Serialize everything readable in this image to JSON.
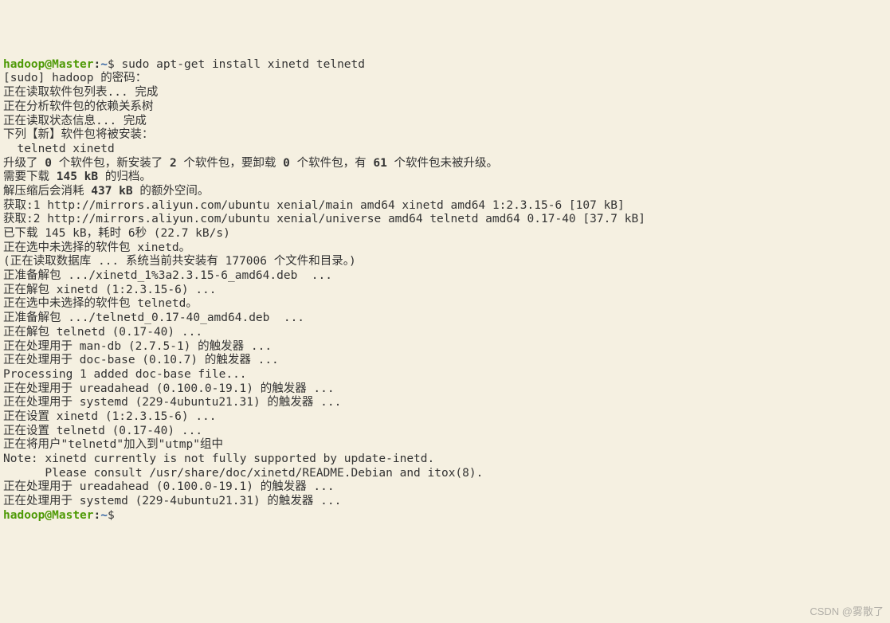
{
  "prompt": {
    "user": "hadoop",
    "host": "Master",
    "path": "~",
    "symbol": "$"
  },
  "command": "sudo apt-get install xinetd telnetd",
  "lines": {
    "l1": "[sudo] hadoop 的密码：",
    "l2": "正在读取软件包列表... 完成",
    "l3": "正在分析软件包的依赖关系树",
    "l4": "正在读取状态信息... 完成",
    "l5": "下列【新】软件包将被安装：",
    "l6": "  telnetd xinetd",
    "upgrade_a": "升级了 ",
    "upgrade_n1": "0",
    "upgrade_b": " 个软件包，新安装了 ",
    "upgrade_n2": "2",
    "upgrade_c": " 个软件包，要卸载 ",
    "upgrade_n3": "0",
    "upgrade_d": " 个软件包，有 ",
    "upgrade_n4": "61",
    "upgrade_e": " 个软件包未被升级。",
    "dl_a": "需要下载 ",
    "dl_n": "145 kB",
    "dl_b": " 的归档。",
    "sp_a": "解压缩后会消耗 ",
    "sp_n": "437 kB",
    "sp_b": " 的额外空间。",
    "l10": "获取:1 http://mirrors.aliyun.com/ubuntu xenial/main amd64 xinetd amd64 1:2.3.15-6 [107 kB]",
    "l11": "获取:2 http://mirrors.aliyun.com/ubuntu xenial/universe amd64 telnetd amd64 0.17-40 [37.7 kB]",
    "l12": "已下载 145 kB，耗时 6秒 (22.7 kB/s)",
    "l13": "正在选中未选择的软件包 xinetd。",
    "l14": "(正在读取数据库 ... 系统当前共安装有 177006 个文件和目录。)",
    "l15": "正准备解包 .../xinetd_1%3a2.3.15-6_amd64.deb  ...",
    "l16": "正在解包 xinetd (1:2.3.15-6) ...",
    "l17": "正在选中未选择的软件包 telnetd。",
    "l18": "正准备解包 .../telnetd_0.17-40_amd64.deb  ...",
    "l19": "正在解包 telnetd (0.17-40) ...",
    "l20": "正在处理用于 man-db (2.7.5-1) 的触发器 ...",
    "l21": "正在处理用于 doc-base (0.10.7) 的触发器 ...",
    "l22": "Processing 1 added doc-base file...",
    "l23": "正在处理用于 ureadahead (0.100.0-19.1) 的触发器 ...",
    "l24": "正在处理用于 systemd (229-4ubuntu21.31) 的触发器 ...",
    "l25": "正在设置 xinetd (1:2.3.15-6) ...",
    "l26": "正在设置 telnetd (0.17-40) ...",
    "l27": "正在将用户\"telnetd\"加入到\"utmp\"组中",
    "l28": "Note: xinetd currently is not fully supported by update-inetd.",
    "l29": "      Please consult /usr/share/doc/xinetd/README.Debian and itox(8).",
    "l30": "正在处理用于 ureadahead (0.100.0-19.1) 的触发器 ...",
    "l31": "正在处理用于 systemd (229-4ubuntu21.31) 的触发器 ..."
  },
  "watermark": "CSDN @雾散了"
}
